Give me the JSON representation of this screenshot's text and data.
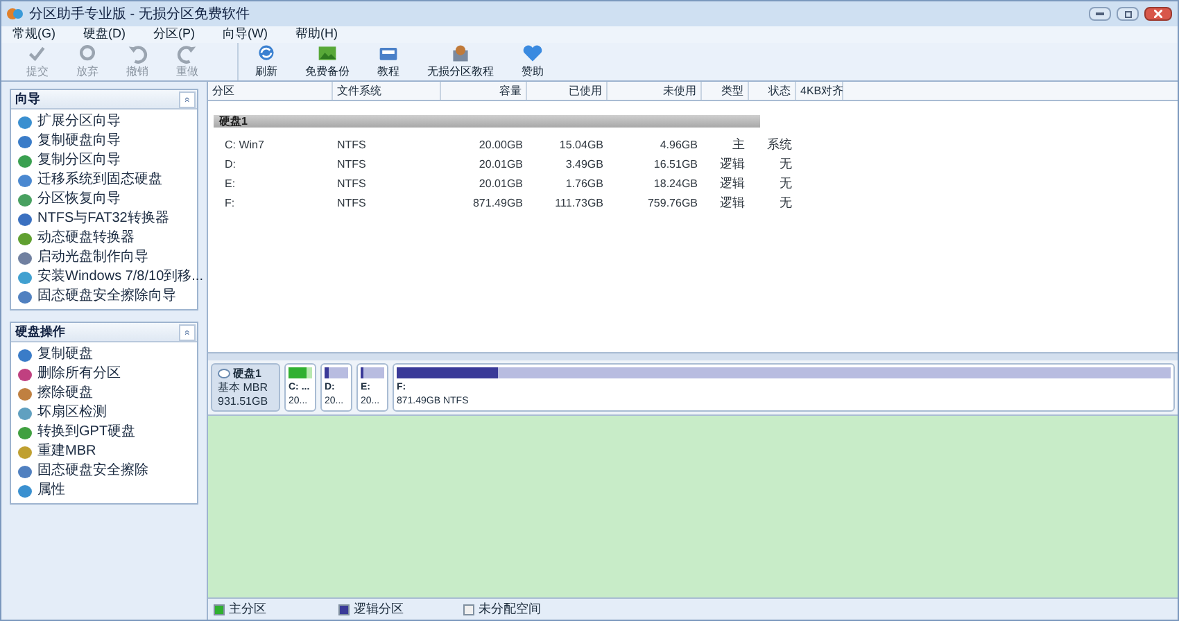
{
  "window": {
    "title": "分区助手专业版 - 无损分区免费软件"
  },
  "menu": [
    "常规(G)",
    "硬盘(D)",
    "分区(P)",
    "向导(W)",
    "帮助(H)"
  ],
  "toolbar": [
    {
      "label": "提交",
      "kind": "check",
      "disabled": true
    },
    {
      "label": "放弃",
      "kind": "discard",
      "disabled": true
    },
    {
      "label": "撤销",
      "kind": "undo",
      "disabled": true
    },
    {
      "label": "重做",
      "kind": "redo",
      "disabled": true
    },
    {
      "label": "刷新",
      "kind": "refresh",
      "disabled": false
    },
    {
      "label": "免费备份",
      "kind": "backup",
      "disabled": false
    },
    {
      "label": "教程",
      "kind": "book",
      "disabled": false
    },
    {
      "label": "无损分区教程",
      "kind": "tutorial",
      "disabled": false
    },
    {
      "label": "赞助",
      "kind": "heart",
      "disabled": false
    }
  ],
  "sidebar": [
    {
      "title": "向导",
      "toggle": "«",
      "items": [
        {
          "label": "扩展分区向导",
          "color": "#3a8fd0"
        },
        {
          "label": "复制硬盘向导",
          "color": "#3a7cc8"
        },
        {
          "label": "复制分区向导",
          "color": "#3aa050"
        },
        {
          "label": "迁移系统到固态硬盘",
          "color": "#4a88d0"
        },
        {
          "label": "分区恢复向导",
          "color": "#48a060"
        },
        {
          "label": "NTFS与FAT32转换器",
          "color": "#3a70c0"
        },
        {
          "label": "动态硬盘转换器",
          "color": "#60a030"
        },
        {
          "label": "启动光盘制作向导",
          "color": "#7080a0"
        },
        {
          "label": "安装Windows 7/8/10到移...",
          "color": "#40a0d0"
        },
        {
          "label": "固态硬盘安全擦除向导",
          "color": "#5080c0"
        }
      ]
    },
    {
      "title": "硬盘操作",
      "toggle": "«",
      "items": [
        {
          "label": "复制硬盘",
          "color": "#3a7cc8"
        },
        {
          "label": "删除所有分区",
          "color": "#c04080"
        },
        {
          "label": "擦除硬盘",
          "color": "#c08040"
        },
        {
          "label": "坏扇区检测",
          "color": "#60a0c0"
        },
        {
          "label": "转换到GPT硬盘",
          "color": "#40a040"
        },
        {
          "label": "重建MBR",
          "color": "#c0a030"
        },
        {
          "label": "固态硬盘安全擦除",
          "color": "#5080c0"
        },
        {
          "label": "属性",
          "color": "#3a90d0"
        }
      ]
    }
  ],
  "table": {
    "columns": [
      "分区",
      "文件系统",
      "容量",
      "已使用",
      "未使用",
      "类型",
      "状态",
      "4KB对齐"
    ],
    "disk_label": "硬盘1",
    "rows": [
      [
        "C: Win7",
        "NTFS",
        "20.00GB",
        "15.04GB",
        "4.96GB",
        "主",
        "系统"
      ],
      [
        "D:",
        "NTFS",
        "20.01GB",
        "3.49GB",
        "16.51GB",
        "逻辑",
        "无"
      ],
      [
        "E:",
        "NTFS",
        "20.01GB",
        "1.76GB",
        "18.24GB",
        "逻辑",
        "无"
      ],
      [
        "F:",
        "NTFS",
        "871.49GB",
        "111.73GB",
        "759.76GB",
        "逻辑",
        "无"
      ]
    ]
  },
  "disk_map": {
    "disk": {
      "name": "硬盘1",
      "type": "基本 MBR",
      "size": "931.51GB"
    },
    "partitions": [
      {
        "name": "C: ...",
        "info": "20...",
        "kind": "primary",
        "level": 0.75
      },
      {
        "name": "D:",
        "info": "20...",
        "kind": "logical",
        "level": 0.17
      },
      {
        "name": "E:",
        "info": "20...",
        "kind": "logical",
        "level": 0.09
      },
      {
        "name": "F:",
        "info": "871.49GB NTFS",
        "kind": "logical",
        "level": 0.13
      }
    ]
  },
  "legend": [
    {
      "label": "主分区",
      "kind": "primary"
    },
    {
      "label": "逻辑分区",
      "kind": "logical"
    },
    {
      "label": "未分配空间",
      "kind": "unallocated"
    }
  ]
}
